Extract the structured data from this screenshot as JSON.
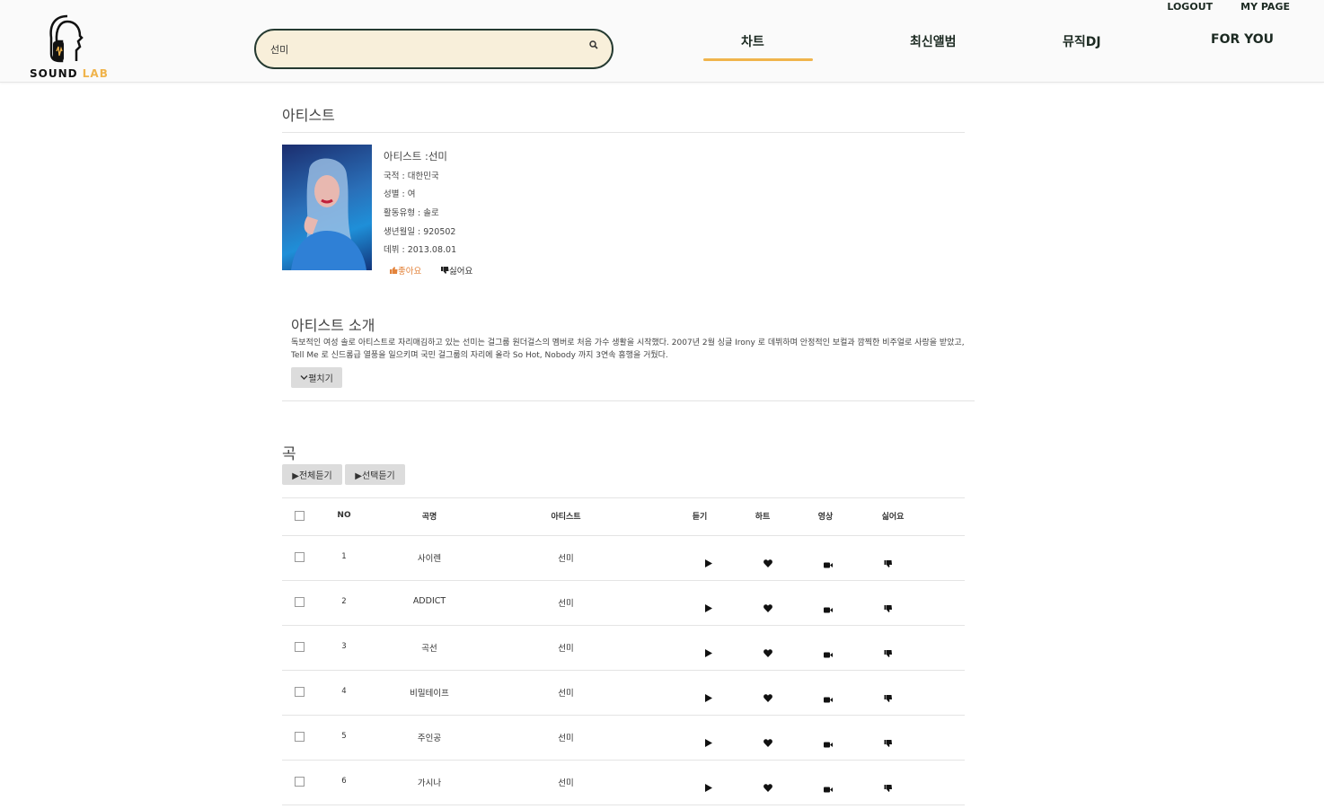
{
  "header": {
    "logo_word1": "SOUND",
    "logo_word2": "LAB",
    "logout": "LOGOUT",
    "mypage": "MY PAGE",
    "search_value": "선미",
    "nav": [
      "차트",
      "최신앨범",
      "뮤직DJ",
      "FOR YOU"
    ],
    "accent": "#f0b44c",
    "dark": "#253a31"
  },
  "artist": {
    "section_title": "아티스트",
    "name": "아티스트 :선미",
    "nationality": "국적 : 대한민국",
    "gender": "성별 : 여",
    "type": "활동유형 : 솔로",
    "birth": "생년월일 : 920502",
    "debut": "데뷔 : 2013.08.01",
    "like_label": "좋아요",
    "dislike_label": "싫어요"
  },
  "intro": {
    "title": "아티스트 소개",
    "text": "독보적인 여성 솔로 아티스트로 자리매김하고 있는 선미는 걸그룹 원더걸스의 멤버로 처음 가수 생활을 시작했다. 2007년 2월 싱글 Irony 로 데뷔하며 안정적인 보컬과 깜찍한 비주얼로 사랑을 받았고, Tell Me 로 신드롬급 열풍을 일으키며 국민 걸그룹의 자리에 올라 So Hot, Nobody 까지 3연속 흥행을 거뒀다.",
    "expand_label": "펼치기"
  },
  "songs": {
    "title": "곡",
    "play_all": "▶전체듣기",
    "play_selected": "▶선택듣기",
    "columns": [
      "NO",
      "곡명",
      "아티스트",
      "듣기",
      "하트",
      "영상",
      "싫어요"
    ],
    "rows": [
      {
        "no": "1",
        "title": "사이렌",
        "artist": "선미"
      },
      {
        "no": "2",
        "title": "ADDICT",
        "artist": "선미"
      },
      {
        "no": "3",
        "title": "곡선",
        "artist": "선미"
      },
      {
        "no": "4",
        "title": "비밀테이프",
        "artist": "선미"
      },
      {
        "no": "5",
        "title": "주인공",
        "artist": "선미"
      },
      {
        "no": "6",
        "title": "가시나",
        "artist": "선미"
      }
    ]
  }
}
